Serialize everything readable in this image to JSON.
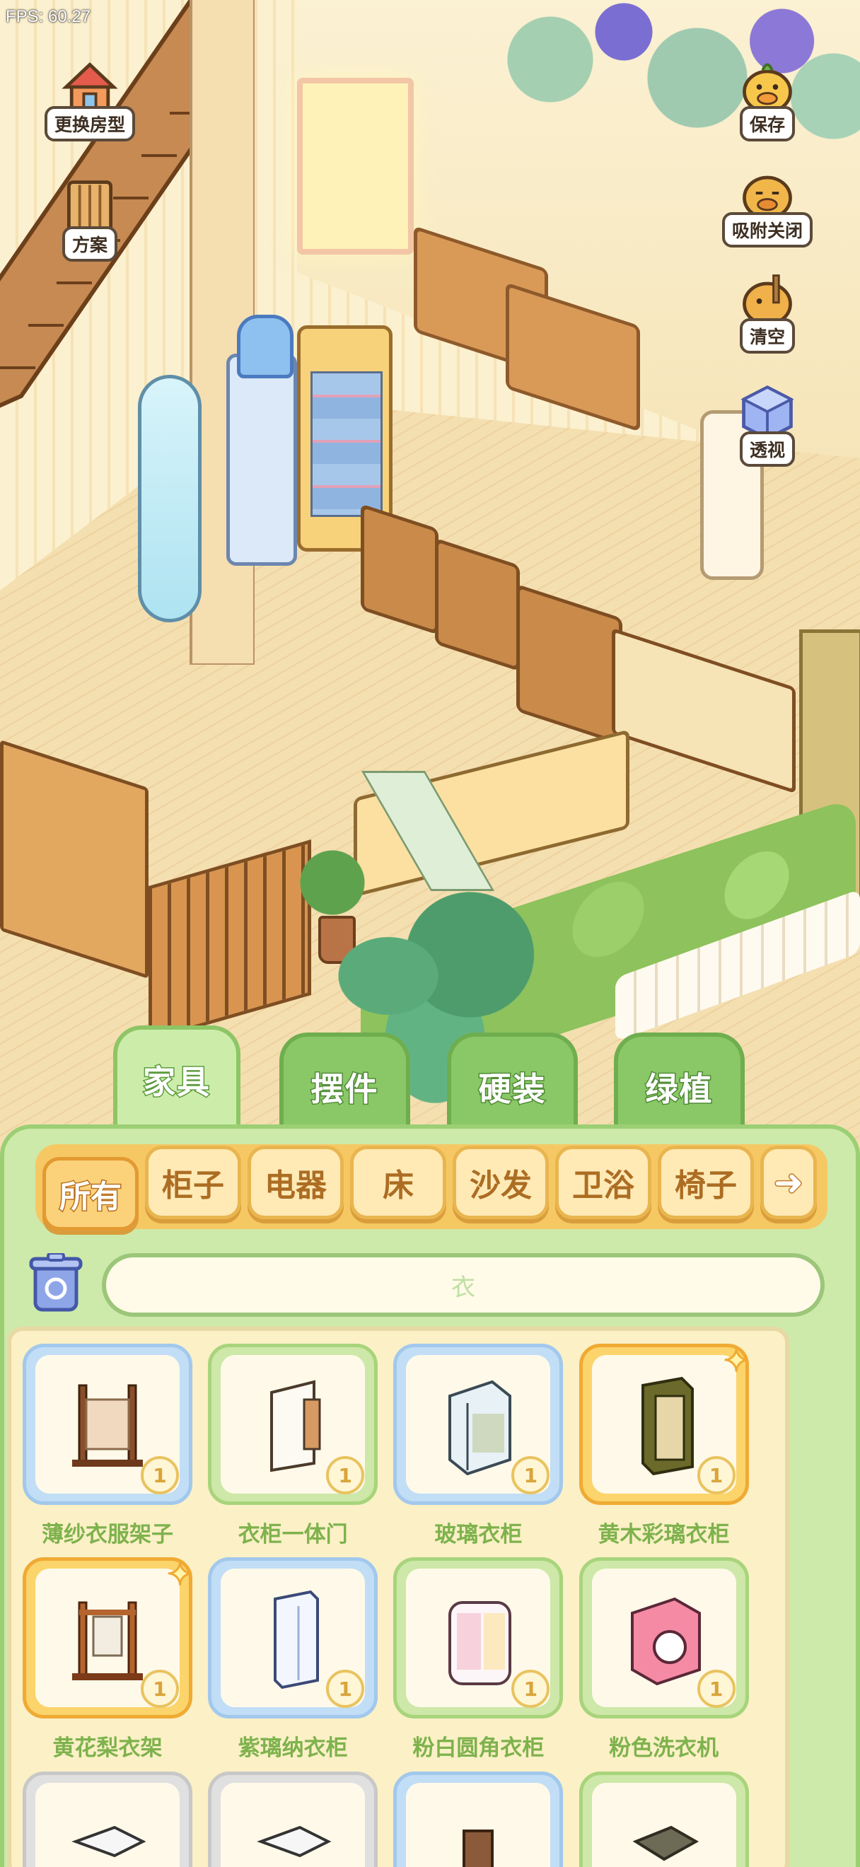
{
  "hud": {
    "fps": "FPS: 60.27"
  },
  "side_left": [
    {
      "label": "更换房型",
      "icon": "house-icon"
    },
    {
      "label": "方案",
      "icon": "book-icon"
    }
  ],
  "side_right": [
    {
      "label": "保存",
      "icon": "duck-save-icon"
    },
    {
      "label": "吸附关闭",
      "icon": "duck-magnet-icon"
    },
    {
      "label": "清空",
      "icon": "duck-clear-icon"
    },
    {
      "label": "透视",
      "icon": "cube-view-icon"
    }
  ],
  "categories": [
    {
      "label": "家具",
      "active": true
    },
    {
      "label": "摆件",
      "active": false
    },
    {
      "label": "硬装",
      "active": false
    },
    {
      "label": "绿植",
      "active": false
    }
  ],
  "subcategories": [
    {
      "label": "所有",
      "active": true
    },
    {
      "label": "柜子",
      "active": false
    },
    {
      "label": "电器",
      "active": false
    },
    {
      "label": "床",
      "active": false
    },
    {
      "label": "沙发",
      "active": false
    },
    {
      "label": "卫浴",
      "active": false
    },
    {
      "label": "椅子",
      "active": false
    }
  ],
  "subcategory_more_icon": "arrow-right-icon",
  "search": {
    "value": "衣",
    "trash_icon": "recycle-bin-icon"
  },
  "items": [
    {
      "name": "薄纱衣服架子",
      "count": "1",
      "frame": "blue",
      "icon": "clothes-rack-icon",
      "sparkle": false
    },
    {
      "name": "衣柜一体门",
      "count": "1",
      "frame": "green",
      "icon": "wardrobe-door-icon",
      "sparkle": false
    },
    {
      "name": "玻璃衣柜",
      "count": "1",
      "frame": "blue",
      "icon": "glass-wardrobe-icon",
      "sparkle": false
    },
    {
      "name": "黄木彩璃衣柜",
      "count": "1",
      "frame": "gold",
      "icon": "wood-glass-wardrobe-icon",
      "sparkle": true
    },
    {
      "name": "黄花梨衣架",
      "count": "1",
      "frame": "gold",
      "icon": "rosewood-rack-icon",
      "sparkle": true
    },
    {
      "name": "紫璃纳衣柜",
      "count": "1",
      "frame": "blue",
      "icon": "tall-wardrobe-icon",
      "sparkle": false
    },
    {
      "name": "粉白圆角衣柜",
      "count": "1",
      "frame": "green",
      "icon": "pink-wardrobe-icon",
      "sparkle": false
    },
    {
      "name": "粉色洗衣机",
      "count": "1",
      "frame": "green",
      "icon": "washing-machine-icon",
      "sparkle": false
    },
    {
      "frame": "grey",
      "icon": "white-cabinet-icon"
    },
    {
      "frame": "grey",
      "icon": "white-cabinet-icon"
    },
    {
      "frame": "blue",
      "icon": "wood-cabinet-icon"
    },
    {
      "frame": "green",
      "icon": "dark-cabinet-icon"
    }
  ],
  "colors": {
    "panel": "#cdeaaa",
    "tab_active": "#fbd27a",
    "item_name": "#7eb24d"
  }
}
